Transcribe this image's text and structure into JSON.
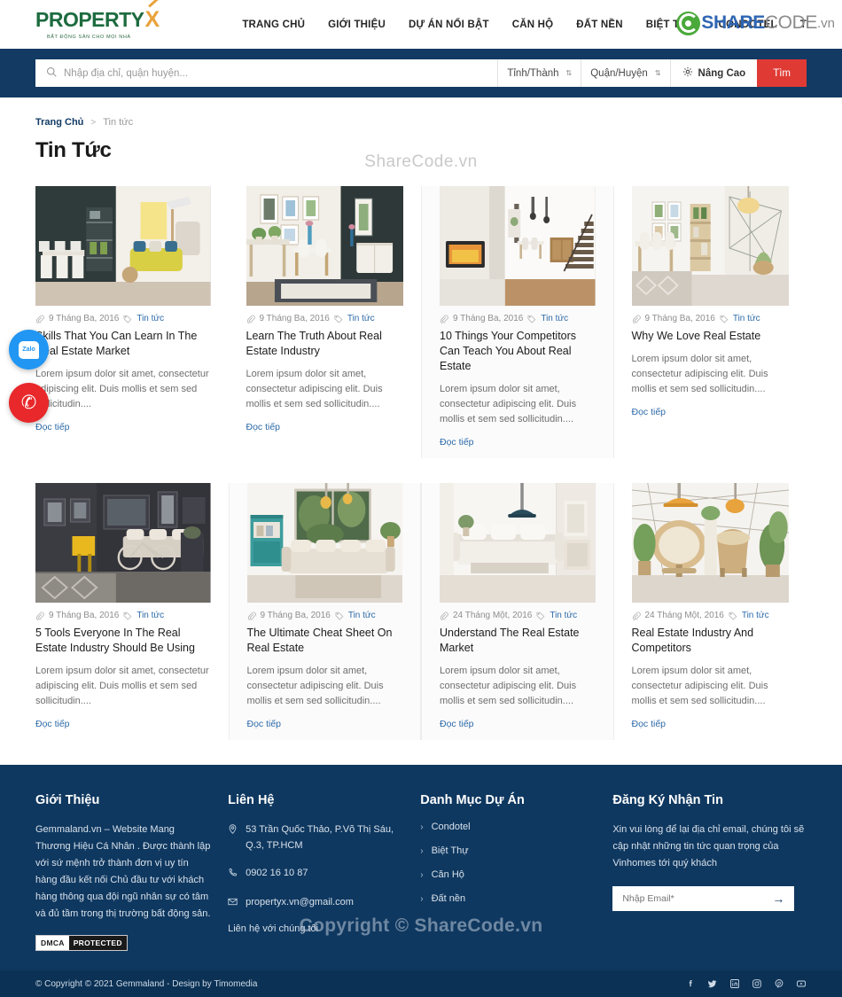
{
  "header": {
    "logo": {
      "text": "PROPERTY",
      "accent_letter": "X",
      "tagline": "BẤT ĐỘNG SẢN CHO MỌI NHÀ"
    },
    "nav": [
      {
        "label": "TRANG CHỦ"
      },
      {
        "label": "GIỚI THIỆU"
      },
      {
        "label": "DỰ ÁN NỔI BẬT"
      },
      {
        "label": "CĂN HỘ"
      },
      {
        "label": "ĐẤT NỀN"
      },
      {
        "label": "BIỆT THỰ"
      },
      {
        "label": "CONDOTEL"
      },
      {
        "label": "T"
      }
    ],
    "sharecode": {
      "share": "SHARE",
      "code": "CODE",
      "vn": ".vn"
    }
  },
  "search": {
    "placeholder": "Nhập địa chỉ, quận huyện...",
    "value": "",
    "province_label": "Tỉnh/Thành",
    "district_label": "Quận/Huyện",
    "advanced_label": "Nâng Cao",
    "submit_label": "Tìm"
  },
  "breadcrumb": {
    "home": "Trang Chủ",
    "separator": ">",
    "current": "Tin tức"
  },
  "page": {
    "title": "Tin Tức",
    "watermark_top": "ShareCode.vn",
    "watermark_bottom": "Copyright © ShareCode.vn"
  },
  "cards": [
    {
      "date": "9 Tháng Ba, 2016",
      "category": "Tin tức",
      "title": "Skills That You Can Learn In The Real Estate Market",
      "excerpt": "Lorem ipsum dolor sit amet, consectetur adipiscing elit. Duis mollis et sem sed sollicitudin....",
      "read_more": "Đọc tiếp",
      "image_alt": "dining-room-yellow-sofa"
    },
    {
      "date": "9 Tháng Ba, 2016",
      "category": "Tin tức",
      "title": "Learn The Truth About Real Estate Industry",
      "excerpt": "Lorem ipsum dolor sit amet, consectetur adipiscing elit. Duis mollis et sem sed sollicitudin....",
      "read_more": "Đọc tiếp",
      "image_alt": "dining-table-wall-art"
    },
    {
      "date": "9 Tháng Ba, 2016",
      "category": "Tin tức",
      "title": "10 Things Your Competitors Can Teach You About Real Estate",
      "excerpt": "Lorem ipsum dolor sit amet, consectetur adipiscing elit. Duis mollis et sem sed sollicitudin....",
      "read_more": "Đọc tiếp",
      "image_alt": "fireplace-hallway-stairs"
    },
    {
      "date": "9 Tháng Ba, 2016",
      "category": "Tin tức",
      "title": "Why We Love Real Estate",
      "excerpt": "Lorem ipsum dolor sit amet, consectetur adipiscing elit. Duis mollis et sem sed sollicitudin....",
      "read_more": "Đọc tiếp",
      "image_alt": "bright-dining-plants"
    },
    {
      "date": "9 Tháng Ba, 2016",
      "category": "Tin tức",
      "title": "5 Tools Everyone In The Real Estate Industry Should Be Using",
      "excerpt": "Lorem ipsum dolor sit amet, consectetur adipiscing elit. Duis mollis et sem sed sollicitudin....",
      "read_more": "Đọc tiếp",
      "image_alt": "dark-room-bicycle-yellow-chair"
    },
    {
      "date": "9 Tháng Ba, 2016",
      "category": "Tin tức",
      "title": "The Ultimate Cheat Sheet On Real Estate",
      "excerpt": "Lorem ipsum dolor sit amet, consectetur adipiscing elit. Duis mollis et sem sed sollicitudin....",
      "read_more": "Đọc tiếp",
      "image_alt": "living-room-teal-cabinet"
    },
    {
      "date": "24 Tháng Một, 2016",
      "category": "Tin tức",
      "title": "Understand The Real Estate Market",
      "excerpt": "Lorem ipsum dolor sit amet, consectetur adipiscing elit. Duis mollis et sem sed sollicitudin....",
      "read_more": "Đọc tiếp",
      "image_alt": "white-sofa-pendant-lamp"
    },
    {
      "date": "24 Tháng Một, 2016",
      "category": "Tin tức",
      "title": "Real Estate Industry And Competitors",
      "excerpt": "Lorem ipsum dolor sit amet, consectetur adipiscing elit. Duis mollis et sem sed sollicitudin....",
      "read_more": "Đọc tiếp",
      "image_alt": "rattan-hanging-chair-plants"
    }
  ],
  "floating": {
    "zalo_label": "Zalo",
    "phone_label": "call"
  },
  "footer": {
    "about": {
      "title": "Giới Thiệu",
      "text": "Gemmaland.vn – Website Mang Thương Hiệu Cá Nhân . Được thành lập với sứ mệnh trở thành đơn vị uy tín hàng đầu kết nối Chủ đầu tư với khách hàng thông qua đội ngũ nhân sự có tâm và đủ tầm trong thị trường bất động sản.",
      "dmca_left": "DMCA",
      "dmca_right": "PROTECTED"
    },
    "contact": {
      "title": "Liên Hệ",
      "address": "53 Trần Quốc Thảo, P.Võ Thị Sáu, Q.3, TP.HCM",
      "phone": "0902 16 10 87",
      "email": "propertyx.vn@gmail.com",
      "tail": "Liên hệ với chúng tôi"
    },
    "categories": {
      "title": "Danh Mục Dự Án",
      "items": [
        {
          "label": "Condotel"
        },
        {
          "label": "Biệt Thự"
        },
        {
          "label": "Căn Hộ"
        },
        {
          "label": "Đất nền"
        }
      ]
    },
    "newsletter": {
      "title": "Đăng Ký Nhận Tin",
      "text": "Xin vui lòng để lại địa chỉ email, chúng tôi sẽ cập nhật những tin tức quan trọng của Vinhomes tới quý khách",
      "placeholder": "Nhập Email*",
      "value": ""
    },
    "bottom": {
      "copyright": "© Copyright © 2021 Gemmaland - Design by Timomedia",
      "socials": [
        "facebook",
        "twitter",
        "linkedin",
        "instagram",
        "pinterest",
        "youtube"
      ]
    }
  },
  "colors": {
    "brand_navy": "#123a63",
    "footer_navy": "#0f3860",
    "footer_bottom_navy": "#0b3155",
    "accent_red": "#e03a35",
    "link_blue": "#2d6aa8",
    "logo_green": "#1d6b3f",
    "logo_orange": "#e9a23b"
  }
}
